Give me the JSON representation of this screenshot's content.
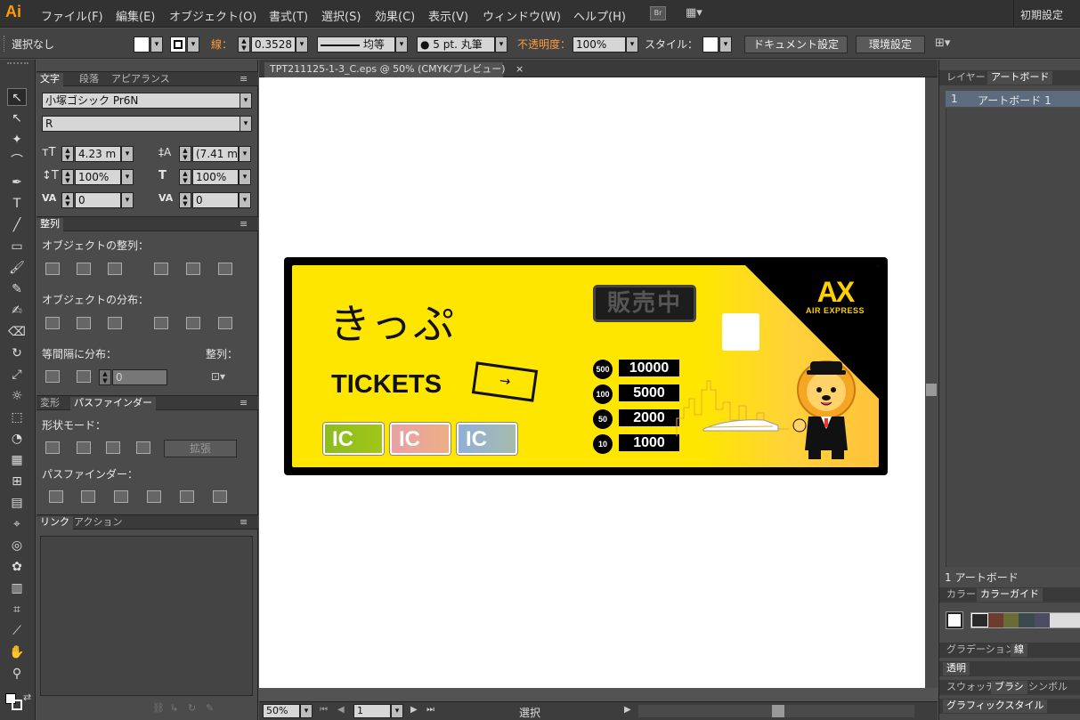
{
  "app": {
    "logo": "Ai",
    "workspace": "初期設定",
    "bridge": "Br"
  },
  "menu": [
    "ファイル(F)",
    "編集(E)",
    "オブジェクト(O)",
    "書式(T)",
    "選択(S)",
    "効果(C)",
    "表示(V)",
    "ウィンドウ(W)",
    "ヘルプ(H)"
  ],
  "control": {
    "selection": "選択なし",
    "stroke_label": "線：",
    "stroke_value": "0.3528",
    "stroke_style": "均等",
    "brush": "5 pt. 丸筆",
    "opacity_label": "不透明度：",
    "opacity_value": "100%",
    "style_label": "スタイル：",
    "doc_settings": "ドキュメント設定",
    "env_settings": "環境設定"
  },
  "char_panel": {
    "tabs": [
      "文字",
      "段落",
      "アピアランス"
    ],
    "font": "小塚ゴシック Pr6N",
    "style": "R",
    "size": "4.23 m",
    "leading": "(7.41 m",
    "vscale": "100%",
    "hscale": "100%",
    "kerning": "0",
    "tracking": "0"
  },
  "align_panel": {
    "tab": "整列",
    "align_objects": "オブジェクトの整列：",
    "distribute_objects": "オブジェクトの分布：",
    "distribute_spacing": "等間隔に分布：",
    "align_to": "整列：",
    "spacing_value": "0"
  },
  "pathfinder_panel": {
    "tabs": [
      "変形",
      "パスファインダー"
    ],
    "shape_modes": "形状モード：",
    "expand": "拡張",
    "pathfinders": "パスファインダー："
  },
  "links_panel": {
    "tabs": [
      "リンク",
      "アクション"
    ]
  },
  "document": {
    "tab_title": "TPT211125-1-3_C.eps @ 50% (CMYK/プレビュー)",
    "close": "×"
  },
  "status": {
    "zoom": "50%",
    "page": "1",
    "tool": "選択"
  },
  "right_panel": {
    "tabs": [
      "レイヤー",
      "アートボード"
    ],
    "artboard_num": "1",
    "artboard_name": "アートボード 1",
    "artboard_count": "1 アートボード",
    "color_tabs": [
      "カラー",
      "カラーガイド"
    ],
    "gradient_tabs": [
      "グラデーション",
      "線"
    ],
    "transparency": "透明",
    "swatch_tabs": [
      "スウォッチ",
      "ブラシ",
      "シンボル"
    ],
    "graphic_styles": "グラフィックスタイル",
    "guide_colors": [
      "#2a2a2a",
      "#6e3b2f",
      "#6b6b35",
      "#3b4a4e",
      "#4b4b62"
    ]
  },
  "artwork": {
    "kippu": "きっぷ",
    "tickets": "TICKETS",
    "arrow": "→",
    "ic": [
      "IC",
      "IC",
      "IC"
    ],
    "ic_colors": [
      "#8bbd1f",
      "#e8a1a6",
      "#8fb0d8"
    ],
    "selling": "販売中",
    "coins": [
      "500",
      "100",
      "50",
      "10"
    ],
    "prices": [
      "10000",
      "5000",
      "2000",
      "1000"
    ],
    "logo_mark": "AX",
    "logo_name": "AIR EXPRESS"
  }
}
